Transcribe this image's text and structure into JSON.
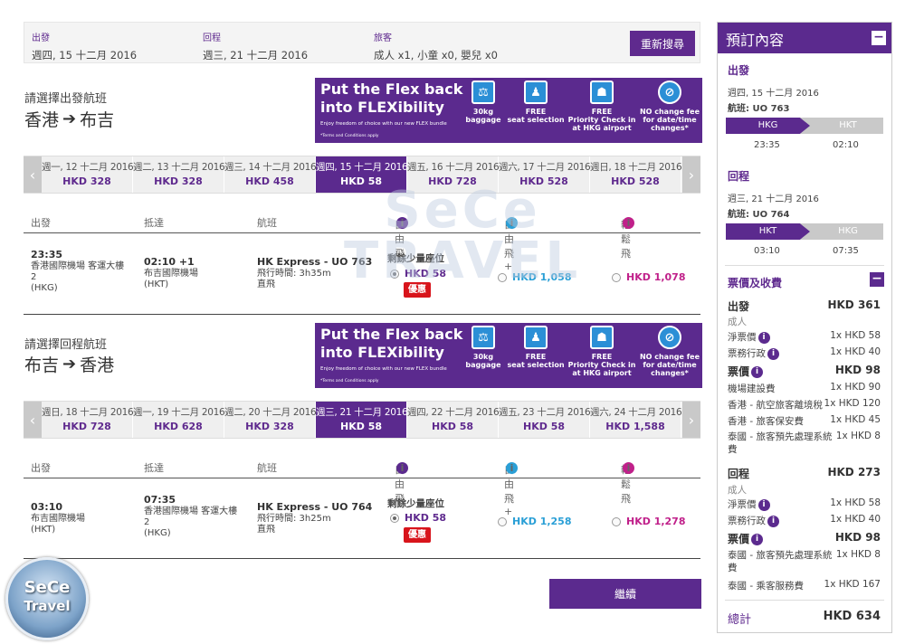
{
  "summary": {
    "depart_label": "出發",
    "depart_value": "週四, 15 十二月 2016",
    "return_label": "回程",
    "return_value": "週三, 21 十二月 2016",
    "pax_label": "旅客",
    "pax_value": "成人 x1, 小童 x0, 嬰兒 x0",
    "research_button": "重新搜尋"
  },
  "promo": {
    "headline1": "Put the Flex back",
    "headline2": "into FLEXibility",
    "fine1": "Enjoy freedom of choice with our new FLEX bundle",
    "fine2": "*Terms and Conditions apply",
    "features": [
      {
        "icon": "baggage-icon",
        "line1": "30kg",
        "line2": "baggage"
      },
      {
        "icon": "seat-icon",
        "line1": "FREE",
        "line2": "seat selection"
      },
      {
        "icon": "priority-checkin-icon",
        "line1": "FREE",
        "line2": "Priority Check in",
        "line3": "at HKG airport"
      },
      {
        "icon": "no-change-fee-icon",
        "line1": "NO change fee",
        "line2": "for date/time",
        "line3": "changes*"
      }
    ]
  },
  "outbound": {
    "title": "請選擇出發航班",
    "from": "香港",
    "to": "布吉",
    "dates": [
      {
        "day": "週一, 12 十二月 2016",
        "price": "HKD 328"
      },
      {
        "day": "週二, 13 十二月 2016",
        "price": "HKD 328"
      },
      {
        "day": "週三, 14 十二月 2016",
        "price": "HKD 458"
      },
      {
        "day": "週四, 15 十二月 2016",
        "price": "HKD 58"
      },
      {
        "day": "週五, 16 十二月 2016",
        "price": "HKD 728"
      },
      {
        "day": "週六, 17 十二月 2016",
        "price": "HKD 528"
      },
      {
        "day": "週日, 18 十二月 2016",
        "price": "HKD 528"
      }
    ],
    "flight": {
      "dep_time": "23:35",
      "dep_airport": "香港國際機場 客運大樓",
      "dep_terminal": "2",
      "dep_code": "(HKG)",
      "arr_time": "02:10 +1",
      "arr_airport": "布吉國際機場",
      "arr_code": "(HKT)",
      "flight_no": "HK Express - UO 763",
      "duration": "飛行時間: 3h35m",
      "type": "直飛",
      "seats_left": "剩餘少量座位",
      "fare_free": "HKD 58",
      "deal": "優惠",
      "fare_plus": "HKD 1,058",
      "fare_light": "HKD 1,078"
    }
  },
  "inbound": {
    "title": "請選擇回程航班",
    "from": "布吉",
    "to": "香港",
    "dates": [
      {
        "day": "週日, 18 十二月 2016",
        "price": "HKD 728"
      },
      {
        "day": "週一, 19 十二月 2016",
        "price": "HKD 628"
      },
      {
        "day": "週二, 20 十二月 2016",
        "price": "HKD 328"
      },
      {
        "day": "週三, 21 十二月 2016",
        "price": "HKD 58"
      },
      {
        "day": "週四, 22 十二月 2016",
        "price": "HKD 58"
      },
      {
        "day": "週五, 23 十二月 2016",
        "price": "HKD 58"
      },
      {
        "day": "週六, 24 十二月 2016",
        "price": "HKD 1,588"
      }
    ],
    "flight": {
      "dep_time": "03:10",
      "dep_airport": "布吉國際機場",
      "dep_code": "(HKT)",
      "arr_time": "07:35",
      "arr_airport": "香港國際機場 客運大樓",
      "arr_terminal": "2",
      "arr_code": "(HKG)",
      "flight_no": "HK Express - UO 764",
      "duration": "飛行時間: 3h25m",
      "type": "直飛",
      "seats_left": "剩餘少量座位",
      "fare_free": "HKD 58",
      "deal": "優惠",
      "fare_plus": "HKD 1,258",
      "fare_light": "HKD 1,278"
    }
  },
  "columns": {
    "dep": "出發",
    "arr": "抵達",
    "flight": "航班",
    "free": "自由飛",
    "plus": "自由飛+",
    "light": "輕鬆飛"
  },
  "continue_button": "繼續",
  "sidebar": {
    "title": "預訂內容",
    "depart_heading": "出發",
    "depart_date": "週四, 15 十二月 2016",
    "depart_flight": "航班: UO 763",
    "depart_from": "HKG",
    "depart_to": "HKT",
    "depart_dep_time": "23:35",
    "depart_arr_time": "02:10",
    "return_heading": "回程",
    "return_date": "週三, 21 十二月 2016",
    "return_flight": "航班: UO 764",
    "return_from": "HKT",
    "return_to": "HKG",
    "return_dep_time": "03:10",
    "return_arr_time": "07:35",
    "fees_heading": "票價及收費",
    "out_label": "出發",
    "out_total": "HKD 361",
    "adult": "成人",
    "net_fare": "淨票價",
    "net_fare_val": "1x HKD 58",
    "admin_fee": "票務行政",
    "admin_fee_val": "1x HKD 40",
    "fare_label": "票價",
    "out_fare_total": "HKD 98",
    "airport_fee": "機場建設費",
    "airport_fee_val": "1x HKD 90",
    "departure_tax": "香港 - 航空旅客離境稅",
    "departure_tax_val": "1x HKD 120",
    "security_fee": "香港 - 旅客保安費",
    "security_fee_val": "1x HKD 45",
    "th_proc_fee": "泰國 - 旅客預先處理系統費",
    "th_proc_fee_val": "1x HKD 8",
    "ret_label": "回程",
    "ret_total": "HKD 273",
    "adult2": "成人",
    "net_fare2": "淨票價",
    "net_fare2_val": "1x HKD 58",
    "admin_fee2": "票務行政",
    "admin_fee2_val": "1x HKD 40",
    "fare_label2": "票價",
    "ret_fare_total": "HKD 98",
    "th_proc_fee2": "泰國 - 旅客預先處理系統費",
    "th_proc_fee2_val": "1x HKD 8",
    "th_service_fee": "泰國 - 乘客服務費",
    "th_service_fee_val": "1x HKD 167",
    "grand_label": "總計",
    "grand_total": "HKD 634"
  },
  "watermark": {
    "line1": "SeCe",
    "line2": "TRAVEL",
    "logo1": "SeCe",
    "logo2": "Travel"
  },
  "colors": {
    "brand": "#5b2a8e",
    "plus": "#2a9fd6",
    "light": "#c0208a",
    "deal": "#d8141b"
  }
}
